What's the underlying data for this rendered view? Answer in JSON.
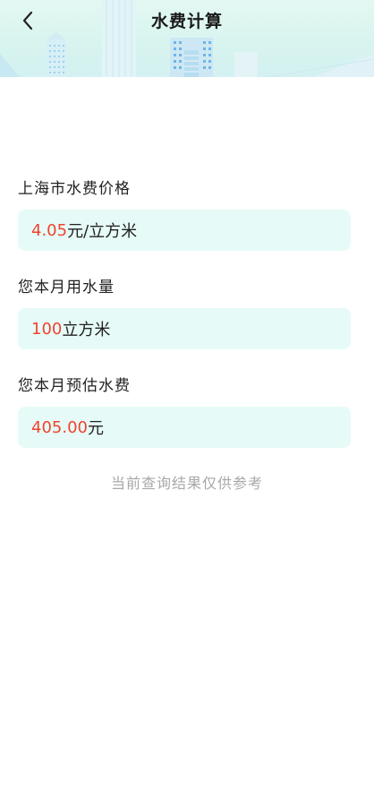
{
  "header": {
    "title": "水费计算",
    "back_icon": "chevron-left-icon",
    "bg_color": "#dff6f1"
  },
  "sections": [
    {
      "label": "上海市水费价格",
      "value": "4.05",
      "unit": "元/立方米"
    },
    {
      "label": "您本月用水量",
      "value": "100",
      "unit": "立方米"
    },
    {
      "label": "您本月预估水费",
      "value": "405.00",
      "unit": "元"
    }
  ],
  "note": "当前查询结果仅供参考",
  "colors": {
    "accent_red": "#f0432e",
    "box_bg": "#e6fbf7",
    "note_gray": "#a8a8a8"
  }
}
